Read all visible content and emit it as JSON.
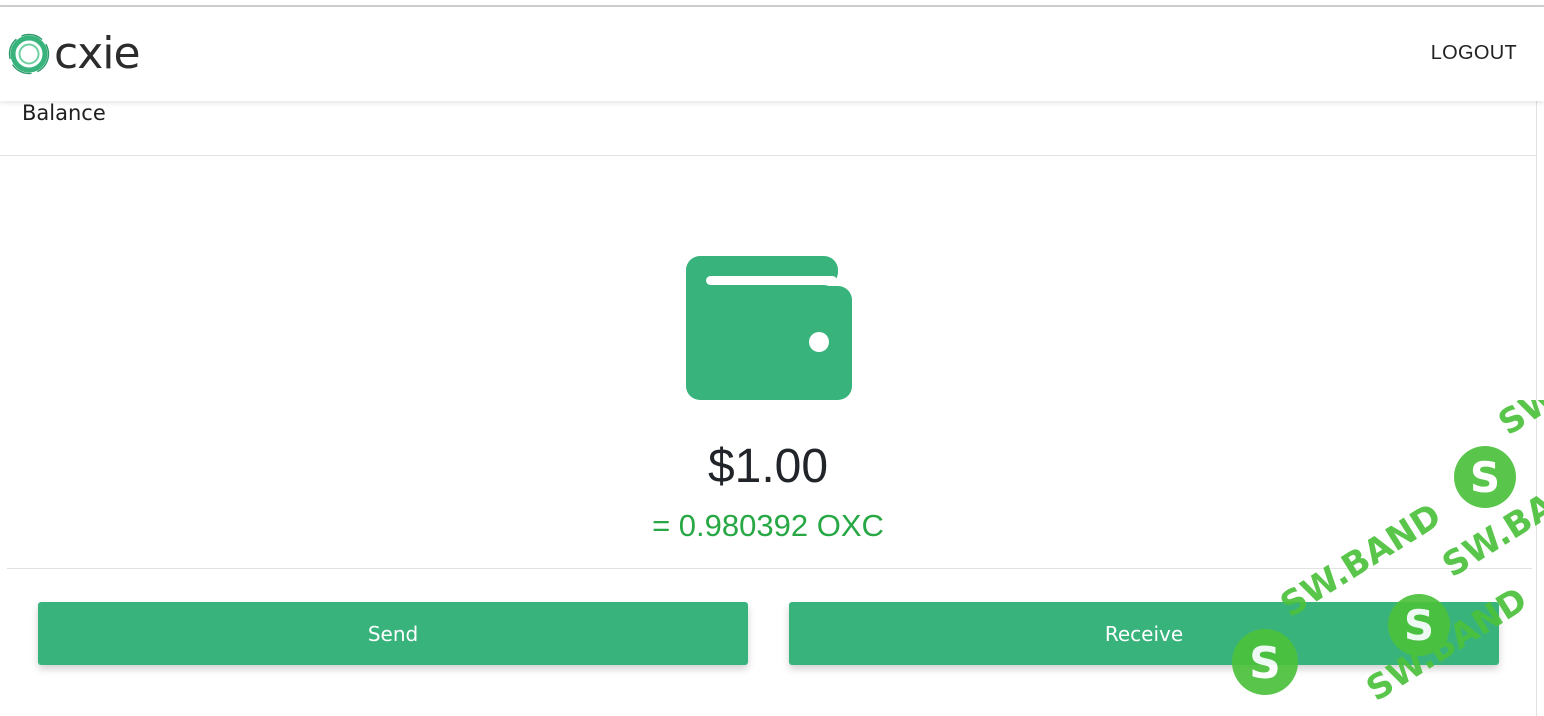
{
  "brand": {
    "name": "cxie",
    "accent_color": "#38b37c"
  },
  "nav": {
    "logout_label": "LOGOUT"
  },
  "balance_card": {
    "title": "Balance",
    "icon": "wallet-icon",
    "amount": "$1.00",
    "crypto_equivalent": "= 0.980392 OXC"
  },
  "actions": {
    "send_label": "Send",
    "receive_label": "Receive"
  },
  "watermark": {
    "text": "SW.BAND",
    "icon": "sw-band-logo-icon"
  },
  "colors": {
    "primary": "#38b37c",
    "crypto_text": "#28a745",
    "amount_text": "#212529"
  }
}
